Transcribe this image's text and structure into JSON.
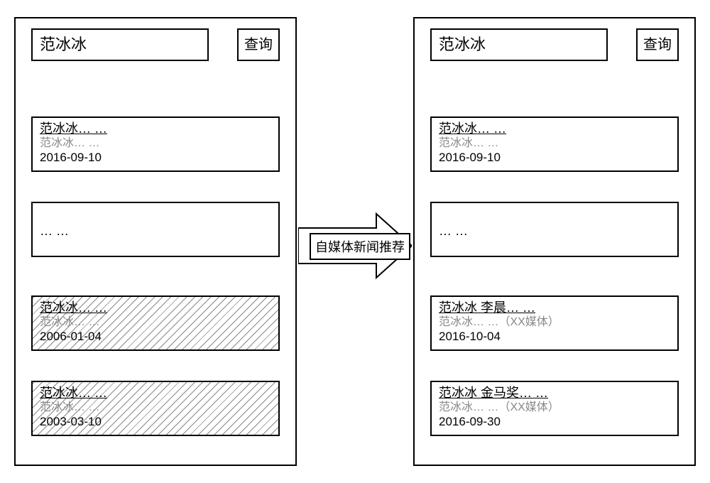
{
  "left": {
    "search_value": "范冰冰",
    "search_btn": "查询",
    "results": {
      "r1": {
        "title": "范冰冰… …",
        "sub": "范冰冰… …",
        "date": "2016-09-10"
      },
      "r2": {
        "ellipsis": "… …"
      },
      "r3": {
        "title": "范冰冰… …",
        "sub": "范冰冰… …",
        "date": "2006-01-04"
      },
      "r4": {
        "title": "范冰冰… …",
        "sub": "范冰冰… …",
        "date": "2003-03-10"
      }
    }
  },
  "right": {
    "search_value": "范冰冰",
    "search_btn": "查询",
    "results": {
      "r1": {
        "title": "范冰冰… …",
        "sub": "范冰冰… …",
        "date": "2016-09-10"
      },
      "r2": {
        "ellipsis": "… …"
      },
      "r3": {
        "title": "范冰冰 李晨… …",
        "sub": "范冰冰… …（XX媒体）",
        "date": "2016-10-04"
      },
      "r4": {
        "title": "范冰冰 金马奖… …",
        "sub": "范冰冰… …（XX媒体）",
        "date": "2016-09-30"
      }
    }
  },
  "arrow_label": "自媒体新闻推荐"
}
